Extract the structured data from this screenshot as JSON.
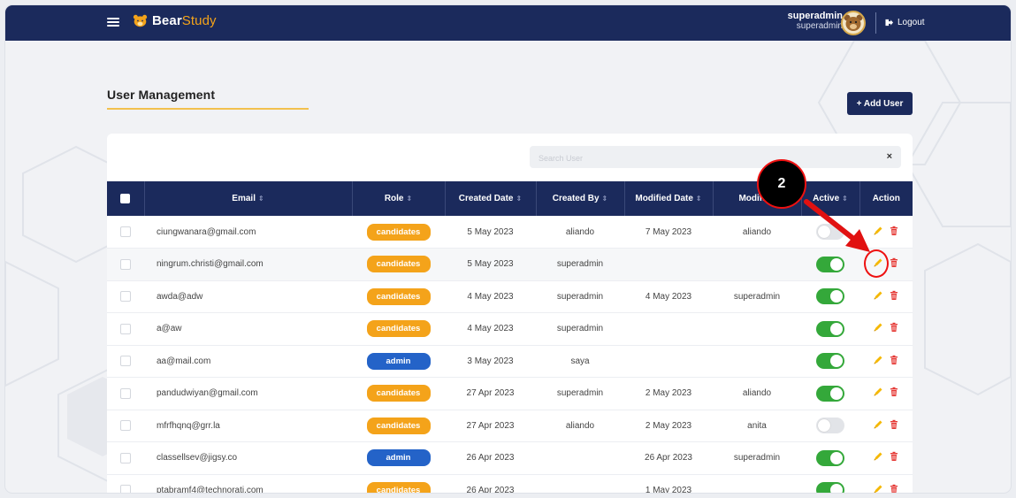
{
  "app": {
    "brand_part1": "Bear",
    "brand_part2": "Study"
  },
  "header": {
    "user_name": "superadmin",
    "user_role": "superadmin",
    "logout_label": "Logout"
  },
  "page": {
    "title": "User Management",
    "add_button": "+ Add User"
  },
  "search": {
    "placeholder": "Search User",
    "clear_symbol": "×"
  },
  "table": {
    "columns": [
      "Email",
      "Role",
      "Created Date",
      "Created By",
      "Modified Date",
      "Modified",
      "Active",
      "Action"
    ],
    "rows": [
      {
        "email": "ciungwanara@gmail.com",
        "role": "candidates",
        "created_date": "5 May 2023",
        "created_by": "aliando",
        "modified_date": "7 May 2023",
        "modified_by": "aliando",
        "active": false
      },
      {
        "email": "ningrum.christi@gmail.com",
        "role": "candidates",
        "created_date": "5 May 2023",
        "created_by": "superadmin",
        "modified_date": "",
        "modified_by": "",
        "active": true
      },
      {
        "email": "awda@adw",
        "role": "candidates",
        "created_date": "4 May 2023",
        "created_by": "superadmin",
        "modified_date": "4 May 2023",
        "modified_by": "superadmin",
        "active": true
      },
      {
        "email": "a@aw",
        "role": "candidates",
        "created_date": "4 May 2023",
        "created_by": "superadmin",
        "modified_date": "",
        "modified_by": "",
        "active": true
      },
      {
        "email": "aa@mail.com",
        "role": "admin",
        "created_date": "3 May 2023",
        "created_by": "saya",
        "modified_date": "",
        "modified_by": "",
        "active": true
      },
      {
        "email": "pandudwiyan@gmail.com",
        "role": "candidates",
        "created_date": "27 Apr 2023",
        "created_by": "superadmin",
        "modified_date": "2 May 2023",
        "modified_by": "aliando",
        "active": true
      },
      {
        "email": "mfrfhqnq@grr.la",
        "role": "candidates",
        "created_date": "27 Apr 2023",
        "created_by": "aliando",
        "modified_date": "2 May 2023",
        "modified_by": "anita",
        "active": false
      },
      {
        "email": "classellsev@jigsy.co",
        "role": "admin",
        "created_date": "26 Apr 2023",
        "created_by": "",
        "modified_date": "26 Apr 2023",
        "modified_by": "superadmin",
        "active": true
      },
      {
        "email": "ptabramf4@technorati.com",
        "role": "candidates",
        "created_date": "26 Apr 2023",
        "created_by": "",
        "modified_date": "1 May 2023",
        "modified_by": "",
        "active": true
      }
    ]
  },
  "annotation": {
    "step_number": "2"
  },
  "colors": {
    "navy": "#1b2a5c",
    "candidates": "#f4a31a",
    "admin": "#2463c8",
    "toggle_on": "#34a83a",
    "edit": "#f5b800",
    "delete": "#e53935",
    "annotation": "#e11111"
  }
}
